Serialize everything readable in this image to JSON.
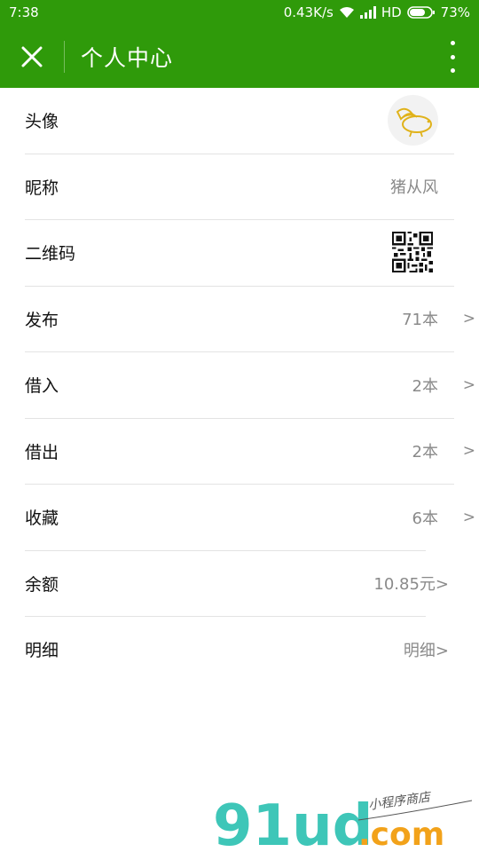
{
  "statusbar": {
    "time": "7:38",
    "speed": "0.43K/s",
    "network": "HD",
    "battery": "73%",
    "icons": [
      "wifi-icon",
      "signal-icon",
      "battery-icon"
    ]
  },
  "titlebar": {
    "title": "个人中心",
    "close_icon": "close-icon",
    "more_icon": "more-vertical-icon",
    "color": "#2f9a0a"
  },
  "rows": [
    {
      "label": "头像",
      "type": "avatar"
    },
    {
      "label": "昵称",
      "value": "猪从风"
    },
    {
      "label": "二维码",
      "type": "qr"
    },
    {
      "label": "发布",
      "value": "71本",
      "chevron": ">"
    },
    {
      "label": "借入",
      "value": "2本",
      "chevron": ">"
    },
    {
      "label": "借出",
      "value": "2本",
      "chevron": ">"
    },
    {
      "label": "收藏",
      "value": "6本",
      "chevron": ">"
    },
    {
      "label": "余额",
      "value": "10.85元>"
    },
    {
      "label": "明细",
      "value": "明细>"
    }
  ],
  "watermark": {
    "brand": "91ud",
    "domain": ".com",
    "tagline": "小程序商店"
  }
}
